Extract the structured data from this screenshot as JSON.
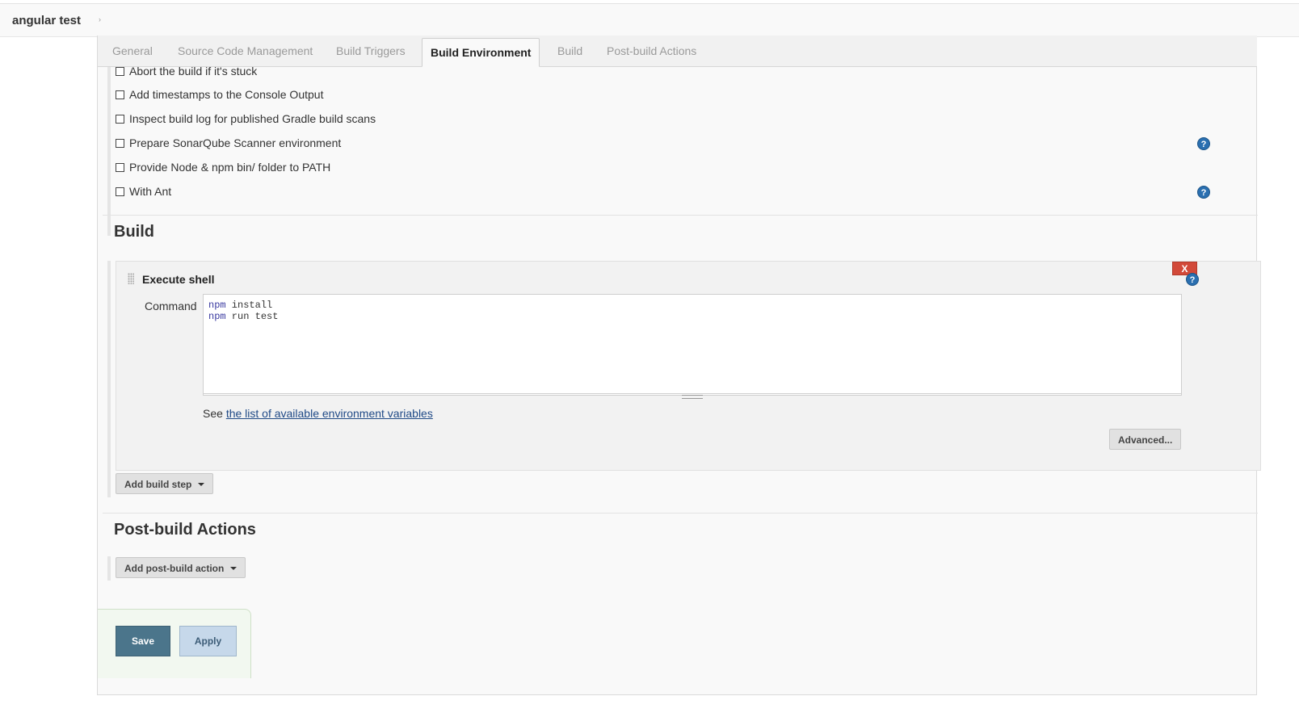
{
  "breadcrumb": {
    "project": "angular test",
    "arrow": "›"
  },
  "tabs": [
    {
      "label": "General"
    },
    {
      "label": "Source Code Management"
    },
    {
      "label": "Build Triggers"
    },
    {
      "label": "Build Environment"
    },
    {
      "label": "Build"
    },
    {
      "label": "Post-build Actions"
    }
  ],
  "active_tab": "Build Environment",
  "build_environment": {
    "options": [
      {
        "label": "Abort the build if it's stuck",
        "checked": false
      },
      {
        "label": "Add timestamps to the Console Output",
        "checked": false
      },
      {
        "label": "Inspect build log for published Gradle build scans",
        "checked": false
      },
      {
        "label": "Prepare SonarQube Scanner environment",
        "checked": false
      },
      {
        "label": "Provide Node & npm bin/ folder to PATH",
        "checked": false
      },
      {
        "label": "With Ant",
        "checked": false
      }
    ]
  },
  "build": {
    "title": "Build",
    "step": {
      "title": "Execute shell",
      "delete_label": "X",
      "command_label": "Command",
      "command_lines": [
        {
          "kw": "npm",
          "rest": " install"
        },
        {
          "kw": "npm",
          "rest": " run test"
        }
      ],
      "env_prefix": "See ",
      "env_link": "the list of available environment variables",
      "advanced_label": "Advanced..."
    },
    "add_step_label": "Add build step"
  },
  "post_build": {
    "title": "Post-build Actions",
    "add_action_label": "Add post-build action"
  },
  "footer": {
    "save_label": "Save",
    "apply_label": "Apply"
  },
  "icons": {
    "help": "help-icon",
    "dropdown": "caret-down-icon",
    "drag": "drag-handle-icon"
  },
  "colors": {
    "help": "#2a6fb0",
    "delete": "#d24939",
    "save": "#4b758b",
    "apply": "#c6d8ea",
    "link": "#204a87"
  }
}
